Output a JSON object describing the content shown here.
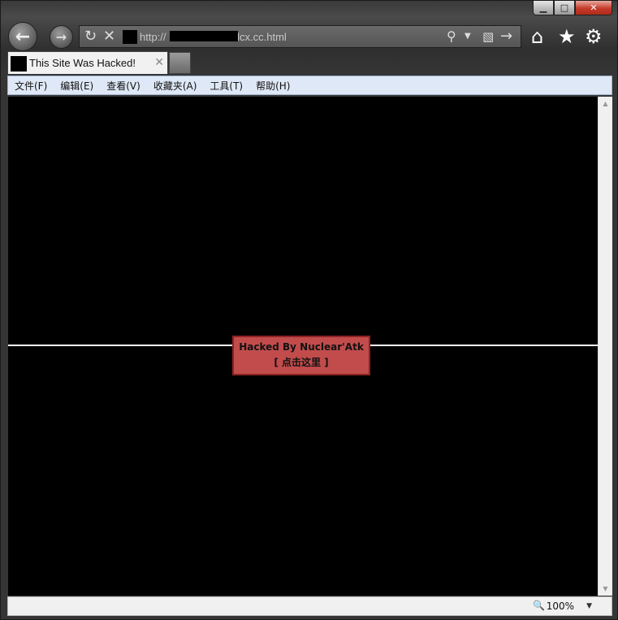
{
  "browser": {
    "address": {
      "url_prefix": "http://",
      "url_suffix": "/lcx.cc.html"
    },
    "tab": {
      "title": "This Site Was Hacked!"
    },
    "menu": [
      "文件(F)",
      "编辑(E)",
      "查看(V)",
      "收藏夹(A)",
      "工具(T)",
      "帮助(H)"
    ],
    "status": {
      "zoom": "100%"
    }
  },
  "page": {
    "line1": "Hacked By Nuclear'Atk",
    "line2": "[ 点击这里 ]",
    "background_color": "#000000",
    "box_color": "#c24c4c"
  },
  "icons": {
    "back": "back-arrow-icon",
    "forward": "forward-arrow-icon",
    "refresh": "refresh-icon",
    "stop": "stop-icon",
    "search": "search-icon",
    "home": "home-icon",
    "favorites": "star-icon",
    "tools": "gear-icon"
  }
}
